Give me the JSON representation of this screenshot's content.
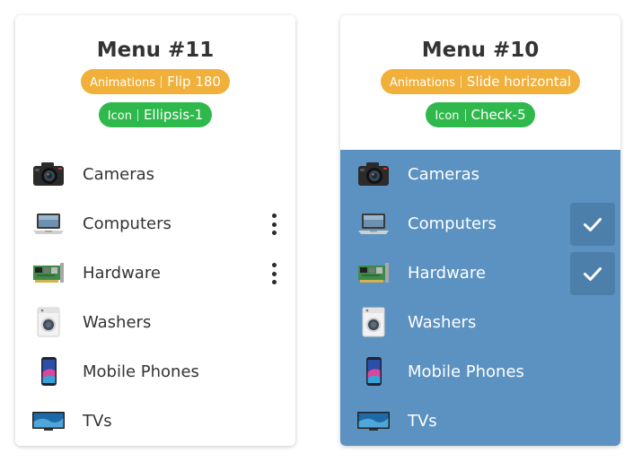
{
  "card_11": {
    "title": "Menu #11",
    "animations_key": "Animations",
    "animations_value": "Flip 180",
    "icon_key": "Icon",
    "icon_value": "Ellipsis-1",
    "items": [
      {
        "label": "Cameras",
        "icon": "camera-icon"
      },
      {
        "label": "Computers",
        "icon": "laptop-icon",
        "action": "kebab"
      },
      {
        "label": "Hardware",
        "icon": "hardware-card-icon",
        "action": "kebab"
      },
      {
        "label": "Washers",
        "icon": "washer-icon"
      },
      {
        "label": "Mobile Phones",
        "icon": "phone-icon"
      },
      {
        "label": "TVs",
        "icon": "tv-icon"
      }
    ]
  },
  "card_10": {
    "title": "Menu #10",
    "animations_key": "Animations",
    "animations_value": "Slide horizontal",
    "icon_key": "Icon",
    "icon_value": "Check-5",
    "menu_background": "#5b92c1",
    "items": [
      {
        "label": "Cameras",
        "icon": "camera-icon"
      },
      {
        "label": "Computers",
        "icon": "laptop-icon",
        "checked": true
      },
      {
        "label": "Hardware",
        "icon": "hardware-card-icon",
        "checked": true
      },
      {
        "label": "Washers",
        "icon": "washer-icon"
      },
      {
        "label": "Mobile Phones",
        "icon": "phone-icon"
      },
      {
        "label": "TVs",
        "icon": "tv-icon"
      }
    ]
  },
  "colors": {
    "animations_badge": "#f0b03a",
    "icon_badge": "#2fb84c"
  }
}
